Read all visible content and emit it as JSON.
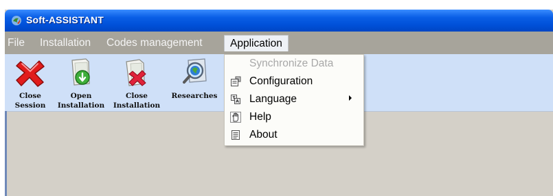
{
  "window": {
    "title": "Soft-ASSISTANT",
    "title_icon": "app-logo-icon"
  },
  "menubar": {
    "items": [
      {
        "label": "File"
      },
      {
        "label": "Installation"
      },
      {
        "label": "Codes management"
      },
      {
        "label": "Application",
        "active": true
      }
    ]
  },
  "toolbar": {
    "buttons": [
      {
        "label": "Close\nSession",
        "icon": "red-x-icon"
      },
      {
        "label": "Open\nInstallation",
        "icon": "open-document-icon"
      },
      {
        "label": "Close\nInstallation",
        "icon": "close-document-icon"
      },
      {
        "label": "Researches",
        "icon": "magnifier-globe-icon"
      }
    ]
  },
  "application_menu": {
    "items": [
      {
        "label": "Synchronize Data",
        "enabled": false,
        "icon": ""
      },
      {
        "label": "Configuration",
        "enabled": true,
        "icon": "configuration-icon"
      },
      {
        "label": "Language",
        "enabled": true,
        "icon": "language-icon",
        "submenu": true
      },
      {
        "label": "Help",
        "enabled": true,
        "icon": "help-hand-icon"
      },
      {
        "label": "About",
        "enabled": true,
        "icon": "about-document-icon"
      }
    ]
  },
  "colors": {
    "titlebar": "#0050d8",
    "menubar": "#a7a49b",
    "toolbar": "#cfe0f8",
    "workspace": "#d4d0c8",
    "disabled_text": "#a8a8a8"
  }
}
